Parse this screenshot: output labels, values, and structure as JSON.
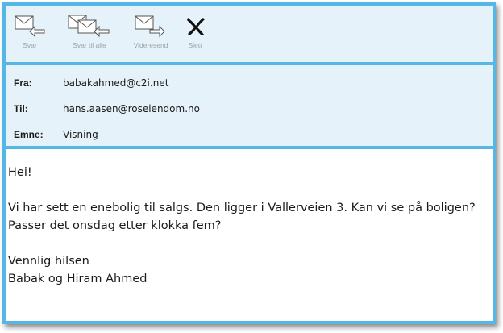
{
  "toolbar": {
    "reply_label": "Svar",
    "reply_all_label": "Svar til alle",
    "forward_label": "Videresend",
    "delete_label": "Slett",
    "icons": [
      "reply-icon",
      "reply-all-icon",
      "forward-icon",
      "delete-icon"
    ]
  },
  "header": {
    "from_label": "Fra:",
    "from_value": "babakahmed@c2i.net",
    "to_label": "Til:",
    "to_value": "hans.aasen@roseiendom.no",
    "subject_label": "Emne:",
    "subject_value": "Visning"
  },
  "message": {
    "greeting": "Hei!",
    "line1": "Vi har sett en enebolig til salgs. Den ligger i Vallerveien 3. Kan vi se på boligen?",
    "line2": "Passer det onsdag etter klokka fem?",
    "closing": "Vennlig hilsen",
    "signature": "Babak og Hiram Ahmed"
  },
  "colors": {
    "accent": "#56b7e6",
    "panel": "#e5f2fa",
    "text": "#1a1a1a"
  }
}
